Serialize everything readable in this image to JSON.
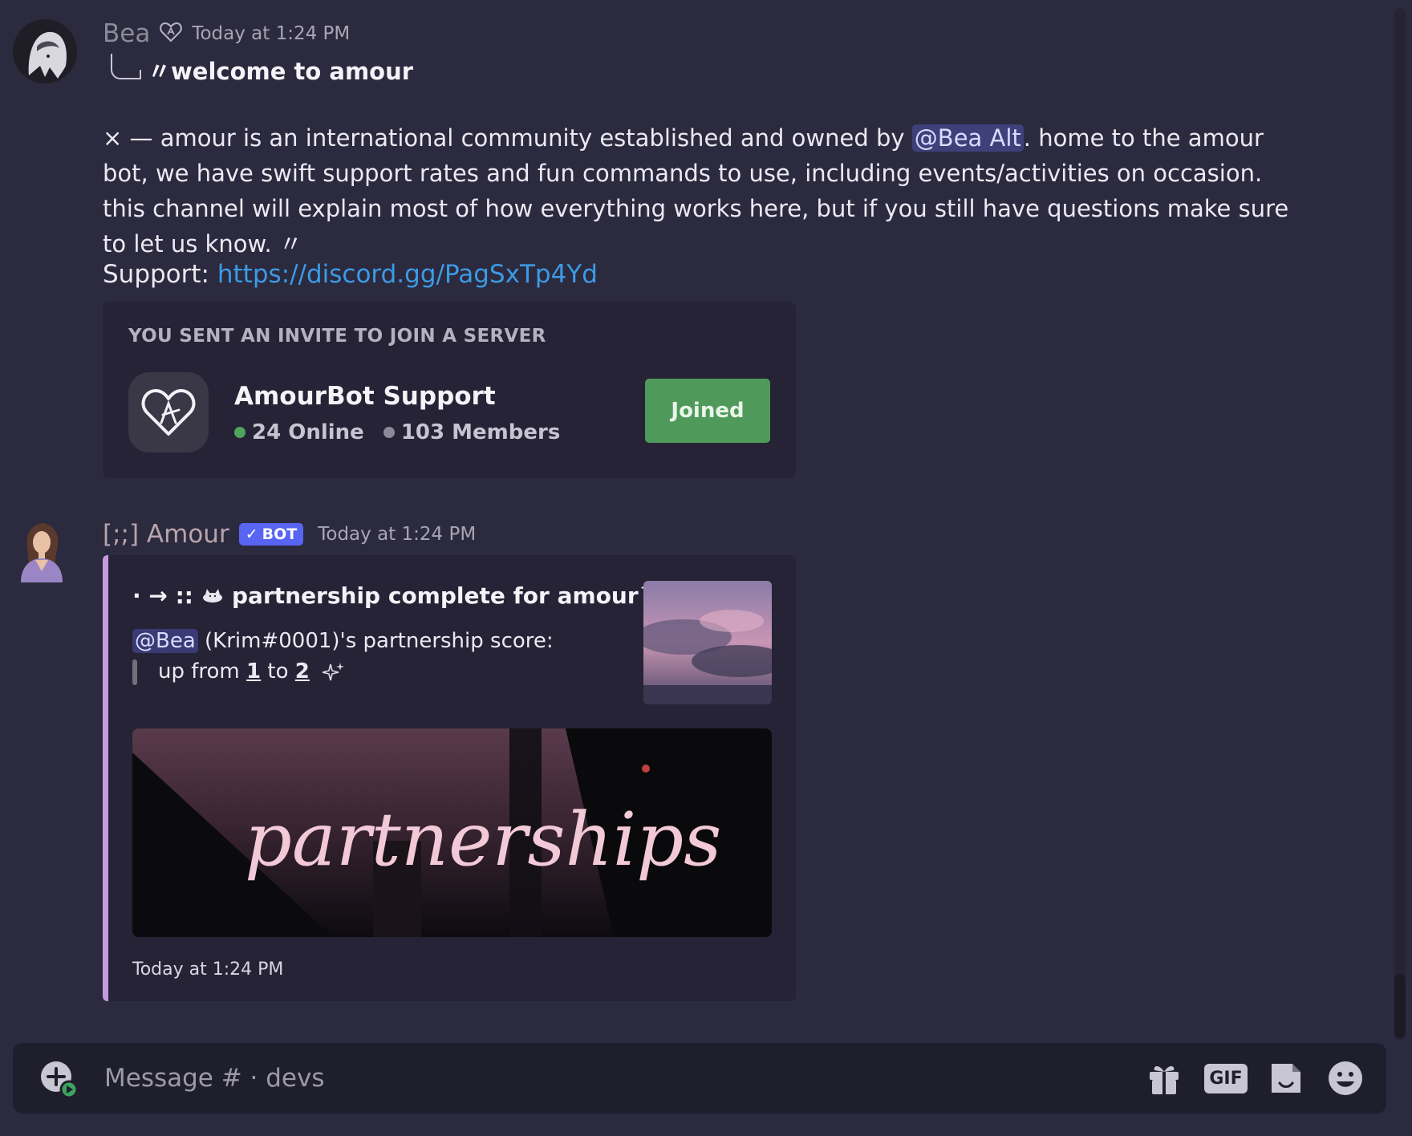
{
  "messages": {
    "m1": {
      "author": "Bea",
      "timestamp": "Today at 1:24 PM",
      "reply_text": "〃welcome to amour",
      "body_pre": "× — amour is an international community established and owned by ",
      "body_mention": "@Bea Alt",
      "body_post": ". home to the amour bot, we have swift support rates and fun commands to use, including events/activities on occasion. this channel will explain most of how everything works here, but if you still have questions make sure to let us know. 〃",
      "support_label": "Support: ",
      "support_link": "https://discord.gg/PagSxTp4Yd"
    },
    "m2": {
      "author": "[;;] Amour",
      "bot_tag": "BOT",
      "timestamp": "Today at 1:24 PM"
    }
  },
  "invite": {
    "header": "YOU SENT AN INVITE TO JOIN A SERVER",
    "server_name": "AmourBot Support",
    "online": "24 Online",
    "members": "103 Members",
    "button": "Joined"
  },
  "embed": {
    "title_prefix": "· → ::",
    "title": "partnership complete for amour™",
    "mention": "@Bea",
    "desc_after_mention": " (Krim#0001)'s partnership score:",
    "up_from": "up from ",
    "from_value": "1",
    "to_word": " to ",
    "to_value": "2",
    "banner_text": "partnerships",
    "footer": "Today at 1:24 PM"
  },
  "composer": {
    "placeholder": "Message # · devs",
    "gif_label": "GIF"
  },
  "colors": {
    "background": "#2c2a3e",
    "card": "#252335",
    "embed_accent": "#c79ae0",
    "joined_button": "#4f9a5a",
    "link": "#3b9be6",
    "bot_tag": "#5865f2"
  },
  "icons": [
    "heart-badge-icon",
    "reply-hook-icon",
    "server-heart-icon",
    "check-icon",
    "add-attachment-icon",
    "gift-icon",
    "gif-icon",
    "sticker-icon",
    "emoji-icon"
  ]
}
